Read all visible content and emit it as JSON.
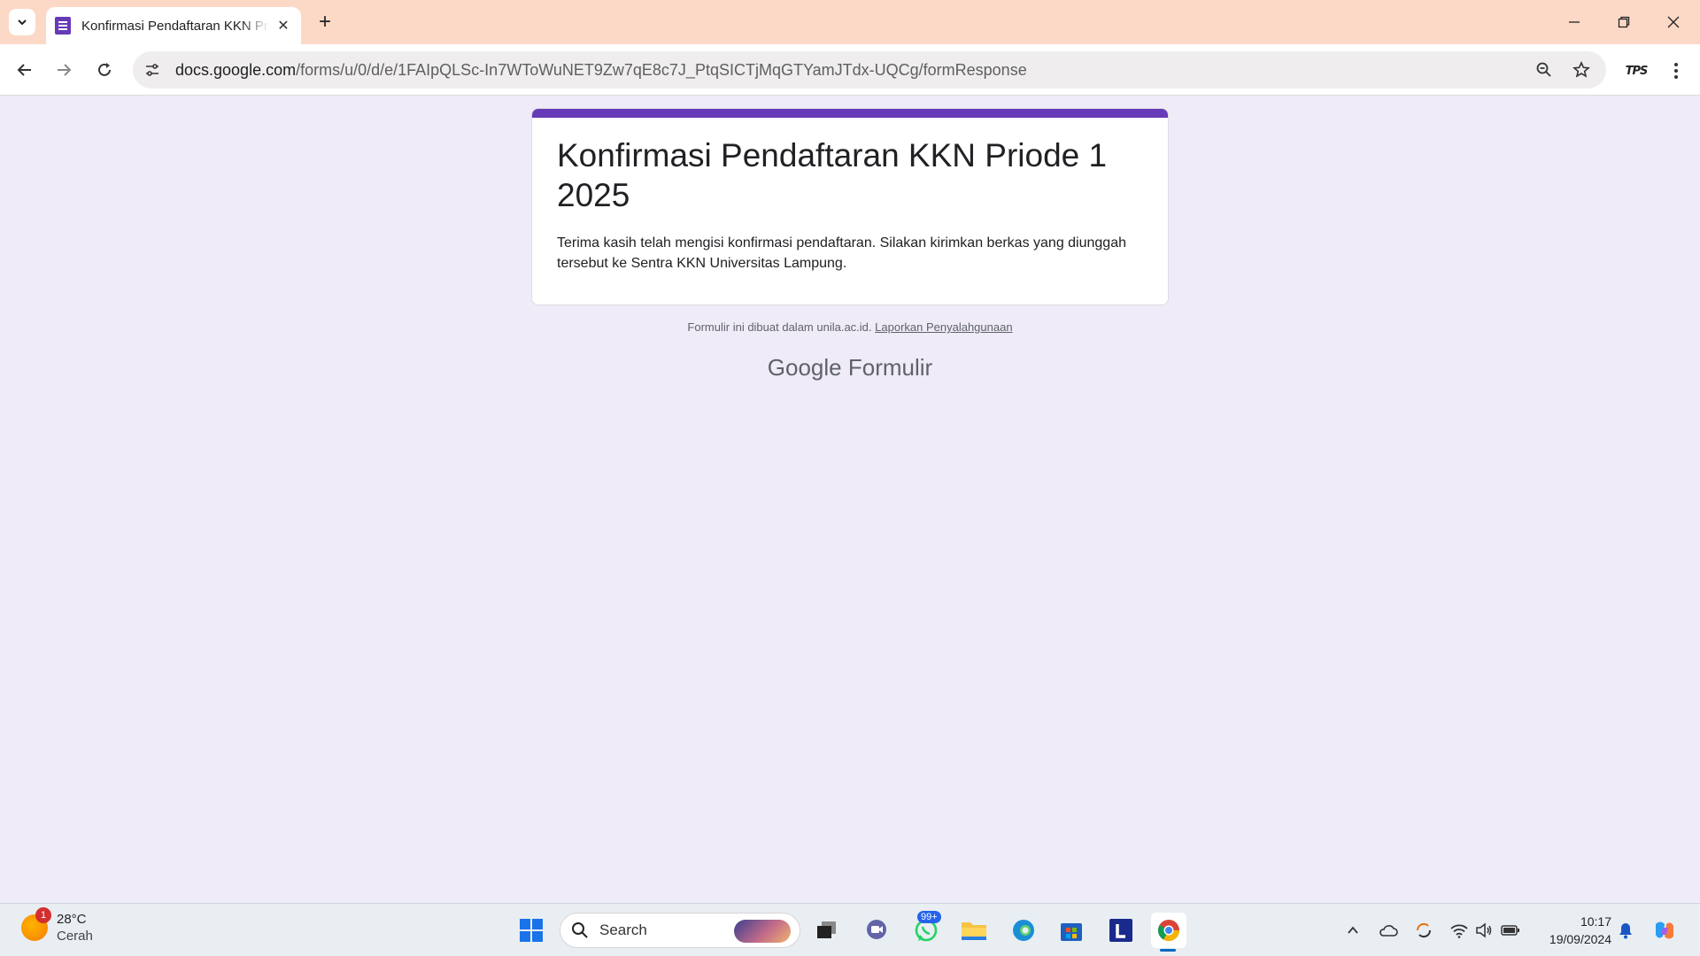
{
  "browser": {
    "tab_title": "Konfirmasi Pendaftaran KKN Priode 1 2025",
    "new_tab": "+",
    "url_host": "docs.google.com",
    "url_path": "/forms/u/0/d/e/1FAIpQLSc-In7WToWuNET9Zw7qE8c7J_PtqSICTjMqGTYamJTdx-UQCg/formResponse",
    "extension_label": "TPS",
    "colors": {
      "titlebar": "#fcd9c6",
      "accent": "#673ab7"
    }
  },
  "form": {
    "title": "Konfirmasi Pendaftaran KKN Priode 1 2025",
    "description": "Terima kasih telah mengisi konfirmasi pendaftaran. Silakan kirimkan berkas yang diunggah tersebut ke Sentra KKN Universitas Lampung.",
    "footer_text": "Formulir ini dibuat dalam unila.ac.id.",
    "report_link": "Laporkan Penyalahgunaan",
    "brand_google": "Google",
    "brand_product": "Formulir"
  },
  "taskbar": {
    "weather_temp": "28°C",
    "weather_cond": "Cerah",
    "weather_badge": "1",
    "search_label": "Search",
    "whatsapp_badge": "99+",
    "time": "10:17",
    "date": "19/09/2024"
  }
}
